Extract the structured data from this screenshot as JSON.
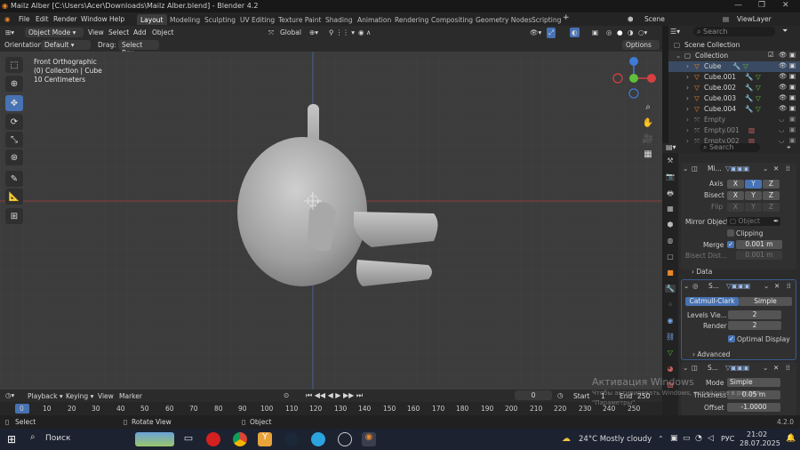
{
  "window": {
    "title": "Mailz Alber [C:\\Users\\Acer\\Downloads\\Mailz Alber.blend] - Blender 4.2"
  },
  "menu": [
    "File",
    "Edit",
    "Render",
    "Window",
    "Help"
  ],
  "workspaces": [
    "Layout",
    "Modeling",
    "Sculpting",
    "UV Editing",
    "Texture Paint",
    "Shading",
    "Animation",
    "Rendering",
    "Compositing",
    "Geometry Nodes",
    "Scripting"
  ],
  "scene": {
    "name": "Scene",
    "view_layer": "ViewLayer"
  },
  "viewport_header": {
    "mode": "Object Mode",
    "items": [
      "View",
      "Select",
      "Add",
      "Object"
    ],
    "transform": "Global",
    "options": "Options"
  },
  "tool_header": {
    "orientation_label": "Orientation:",
    "orientation": "Default",
    "drag_label": "Drag:",
    "drag": "Select Box"
  },
  "viewport_info": {
    "line1": "Front Orthographic",
    "line2": "(0) Collection | Cube",
    "line3": "10 Centimeters"
  },
  "outliner": {
    "search_placeholder": "Search",
    "root": "Scene Collection",
    "collection": "Collection",
    "items": [
      "Cube",
      "Cube.001",
      "Cube.002",
      "Cube.003",
      "Cube.004",
      "Empty",
      "Empty.001",
      "Empty.002"
    ]
  },
  "properties": {
    "search_placeholder": "Search",
    "mirror": {
      "header": "Mi...",
      "axis_label": "Axis",
      "bisect_label": "Bisect",
      "flip_label": "Flip",
      "axes": [
        "X",
        "Y",
        "Z"
      ],
      "mirror_object_label": "Mirror Object",
      "mirror_object_placeholder": "Object",
      "clipping": "Clipping",
      "merge_label": "Merge",
      "merge_value": "0.001 m",
      "bisect_dist_label": "Bisect Dist...",
      "bisect_dist_value": "0.001 m",
      "data": "Data"
    },
    "subsurf": {
      "header": "S...",
      "catmull": "Catmull-Clark",
      "simple": "Simple",
      "levels_label": "Levels Vie...",
      "levels_value": "2",
      "render_label": "Render",
      "render_value": "2",
      "optimal": "Optimal Display",
      "advanced": "Advanced"
    },
    "solidify": {
      "header": "S...",
      "mode_label": "Mode",
      "mode_value": "Simple",
      "thickness_label": "Thickness",
      "thickness_value": "0.05 m",
      "offset_label": "Offset",
      "offset_value": "-1.0000"
    }
  },
  "timeline": {
    "playback": "Playback",
    "keying": "Keying",
    "view": "View",
    "marker": "Marker",
    "current_frame": "0",
    "start_label": "Start",
    "start": "1",
    "end_label": "End",
    "end": "250",
    "ticks": [
      "0",
      "10",
      "20",
      "30",
      "40",
      "50",
      "60",
      "70",
      "80",
      "90",
      "100",
      "110",
      "120",
      "130",
      "140",
      "150",
      "160",
      "170",
      "180",
      "190",
      "200",
      "210",
      "220",
      "230",
      "240",
      "250"
    ]
  },
  "statusbar": {
    "select": "Select",
    "rotate": "Rotate View",
    "object": "Object",
    "version": "4.2.0"
  },
  "watermark": {
    "line1": "Активация Windows",
    "line2": "Чтобы активировать Windows, перейдите в раздел",
    "line3": "\"Параметры\"."
  },
  "taskbar": {
    "search": "Поиск",
    "weather": "24°C  Mostly cloudy",
    "lang": "РУС",
    "time": "21:02",
    "date": "28.07.2025"
  },
  "colors": {
    "accent": "#4772b3",
    "orange": "#e8872a",
    "green": "#5fbf3a"
  }
}
